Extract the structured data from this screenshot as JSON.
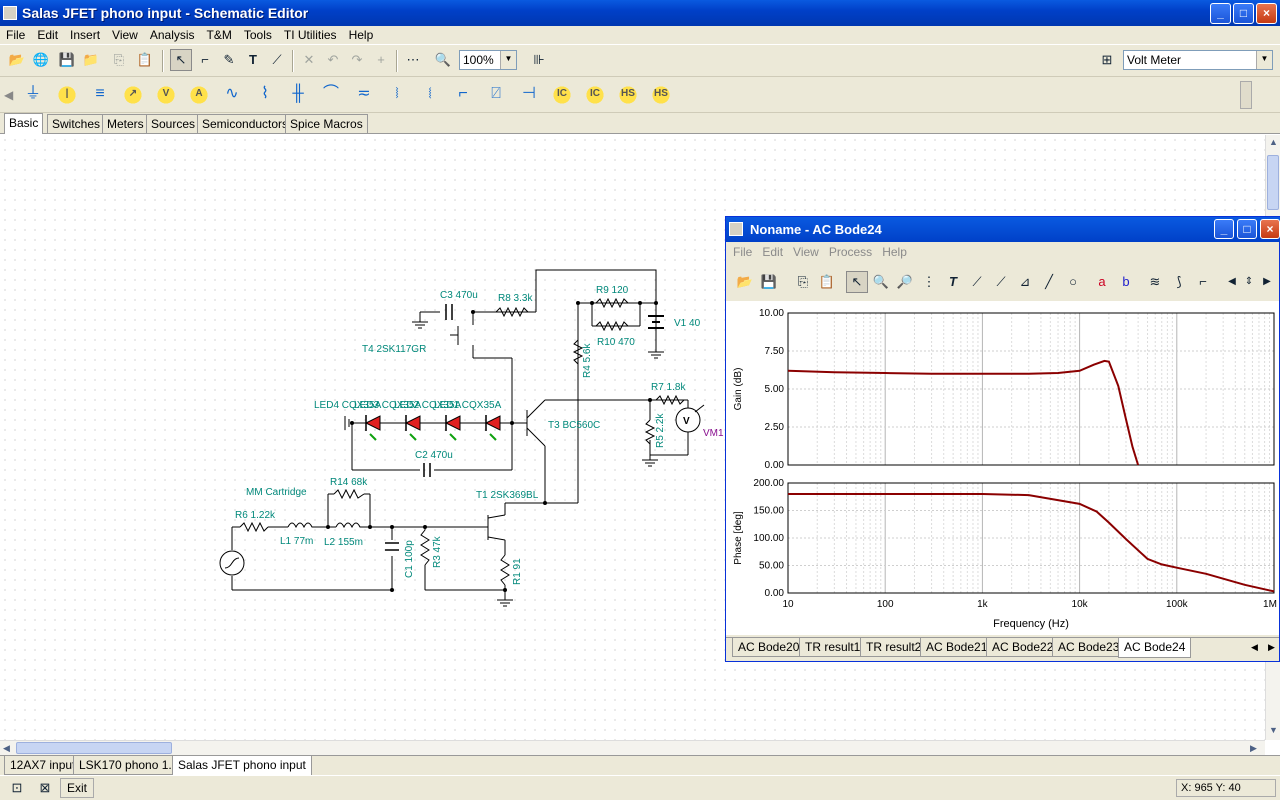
{
  "window": {
    "title": "Salas JFET phono input - Schematic Editor",
    "min": "_",
    "max": "□",
    "close": "×"
  },
  "menu": [
    "File",
    "Edit",
    "Insert",
    "View",
    "Analysis",
    "T&M",
    "Tools",
    "TI Utilities",
    "Help"
  ],
  "toolbar": {
    "zoom": "100%",
    "instrument": "Volt Meter"
  },
  "component_tabs": [
    {
      "label": "Basic",
      "active": true
    },
    {
      "label": "Switches"
    },
    {
      "label": "Meters"
    },
    {
      "label": "Sources"
    },
    {
      "label": "Semiconductors"
    },
    {
      "label": "Spice Macros"
    }
  ],
  "component_glyphs": [
    "IC",
    "IC",
    "HS",
    "HS"
  ],
  "schematic": {
    "labels": {
      "c3": "C3 470u",
      "r8": "R8 3.3k",
      "r9": "R9 120",
      "r10": "R10 470",
      "v1": "V1 40",
      "t4": "T4 2SK117GR",
      "r4": "R4 5.6k",
      "r7": "R7 1.8k",
      "vm1": "VM1",
      "v": "V",
      "led4": "LED4 CQX35A",
      "led3": "LED3 CQX35A",
      "led2": "LED2 CQX35A",
      "led1": "LED1 CQX35A",
      "t3": "T3 BC560C",
      "r5": "R5 2.2k",
      "c2": "C2 470u",
      "mm": "MM Cartridge",
      "r14": "R14 68k",
      "t1": "T1 2SK369BL",
      "r6": "R6 1.22k",
      "l1": "L1 77m",
      "l2": "L2 155m",
      "c1": "C1 100p",
      "r3": "R3 47k",
      "r1": "R1 91"
    }
  },
  "bode": {
    "title": "Noname - AC Bode24",
    "menu": [
      "File",
      "Edit",
      "View",
      "Process",
      "Help"
    ],
    "tool_glyphs": [
      "T",
      "a",
      "b"
    ],
    "gain": {
      "ylabel": "Gain (dB)",
      "ticks": [
        "10.00",
        "7.50",
        "5.00",
        "2.50",
        "0.00"
      ]
    },
    "phase": {
      "ylabel": "Phase [deg]",
      "ticks": [
        "200.00",
        "150.00",
        "100.00",
        "50.00",
        "0.00"
      ]
    },
    "xticks": [
      "10",
      "100",
      "1k",
      "10k",
      "100k",
      "1M"
    ],
    "xlabel": "Frequency (Hz)",
    "tabs": [
      "AC Bode20",
      "TR result1",
      "TR result2",
      "AC Bode21",
      "AC Bode22",
      "AC Bode23",
      "AC Bode24"
    ]
  },
  "chart_data": [
    {
      "type": "line",
      "xscale": "log",
      "xlim": [
        10,
        1000000
      ],
      "ylim": [
        0,
        10
      ],
      "ylabel": "Gain (dB)",
      "xlabel": "Frequency (Hz)",
      "grid": true,
      "x": [
        10,
        30,
        100,
        300,
        1000,
        3000,
        6000,
        10000,
        14000,
        18000,
        20000,
        25000,
        30000,
        35000,
        40000
      ],
      "y": [
        6.2,
        6.1,
        6.05,
        6.0,
        6.0,
        6.0,
        6.05,
        6.2,
        6.6,
        6.85,
        6.8,
        5.2,
        3.0,
        1.2,
        0.0
      ]
    },
    {
      "type": "line",
      "xscale": "log",
      "xlim": [
        10,
        1000000
      ],
      "ylim": [
        0,
        200
      ],
      "ylabel": "Phase [deg]",
      "xlabel": "Frequency (Hz)",
      "grid": true,
      "x": [
        10,
        100,
        1000,
        3000,
        10000,
        15000,
        20000,
        30000,
        50000,
        70000,
        100000,
        200000,
        500000,
        1000000
      ],
      "y": [
        180,
        180,
        180,
        178,
        162,
        148,
        128,
        98,
        62,
        52,
        46,
        35,
        15,
        3
      ]
    }
  ],
  "doc_tabs": [
    {
      "label": "12AX7 input"
    },
    {
      "label": "LSK170 phono 1.1"
    },
    {
      "label": "Salas JFET phono input",
      "active": true
    }
  ],
  "status": {
    "coords": "X: 965  Y: 40",
    "exit": "Exit"
  }
}
